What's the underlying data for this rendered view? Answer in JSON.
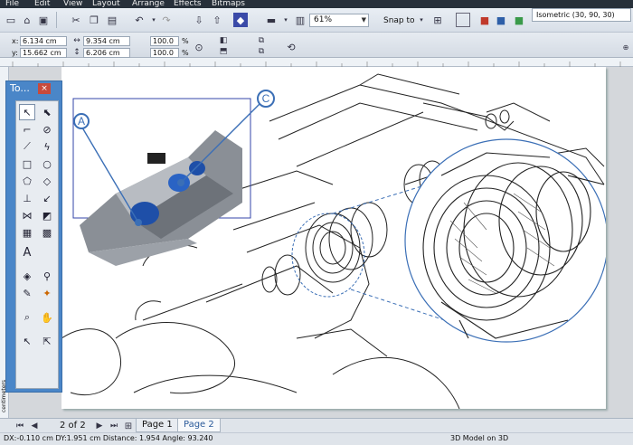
{
  "menu": [
    "File",
    "Edit",
    "View",
    "Layout",
    "Arrange",
    "Effects",
    "Bitmaps"
  ],
  "toolbar": {
    "zoom": "61%",
    "snap_to": "Snap to",
    "view_preset": "Isometric (30, 90, 30)"
  },
  "property_bar": {
    "x_label": "x:",
    "x_value": "6.134 cm",
    "y_label": "y:",
    "y_value": "15.662 cm",
    "width_value": "9.354 cm",
    "height_value": "6.206 cm",
    "scale_x": "100.0",
    "scale_y": "100.0",
    "percent_sign": "%"
  },
  "toolbox": {
    "title": "To...",
    "close": "×"
  },
  "callouts": {
    "a": "A",
    "c": "C"
  },
  "page_nav": {
    "page_count": "2 of 2",
    "tabs": [
      "Page 1",
      "Page 2"
    ],
    "ruler_unit": "centimeters"
  },
  "status": {
    "left": "DX:-0.110 cm DY:1.951 cm Distance: 1.954 Angle: 93.240",
    "center": "3D Model on 3D"
  },
  "colors": {
    "accent": "#4a86c8",
    "callout_blue": "#3b6fb6",
    "selection_blue": "#3344aa"
  }
}
